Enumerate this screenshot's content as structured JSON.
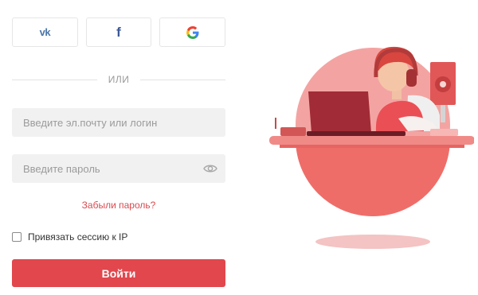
{
  "social": {
    "vk_label": "vk",
    "facebook_label": "f"
  },
  "divider": {
    "text": "ИЛИ"
  },
  "login": {
    "placeholder": "Введите эл.почту или логин",
    "value": ""
  },
  "password": {
    "placeholder": "Введите пароль",
    "value": ""
  },
  "forgot_link": "Забыли пароль?",
  "bind_session": {
    "label": "Привязать сессию к IP",
    "checked": false
  },
  "submit_label": "Войти",
  "colors": {
    "accent": "#e1474d",
    "link": "#d84a4f",
    "vk": "#4a76a8",
    "facebook": "#3b5998",
    "field_bg": "#f1f1f2"
  },
  "icons": {
    "vk": "vk-icon",
    "facebook": "facebook-icon",
    "google": "google-icon",
    "show_password": "eye-icon"
  }
}
